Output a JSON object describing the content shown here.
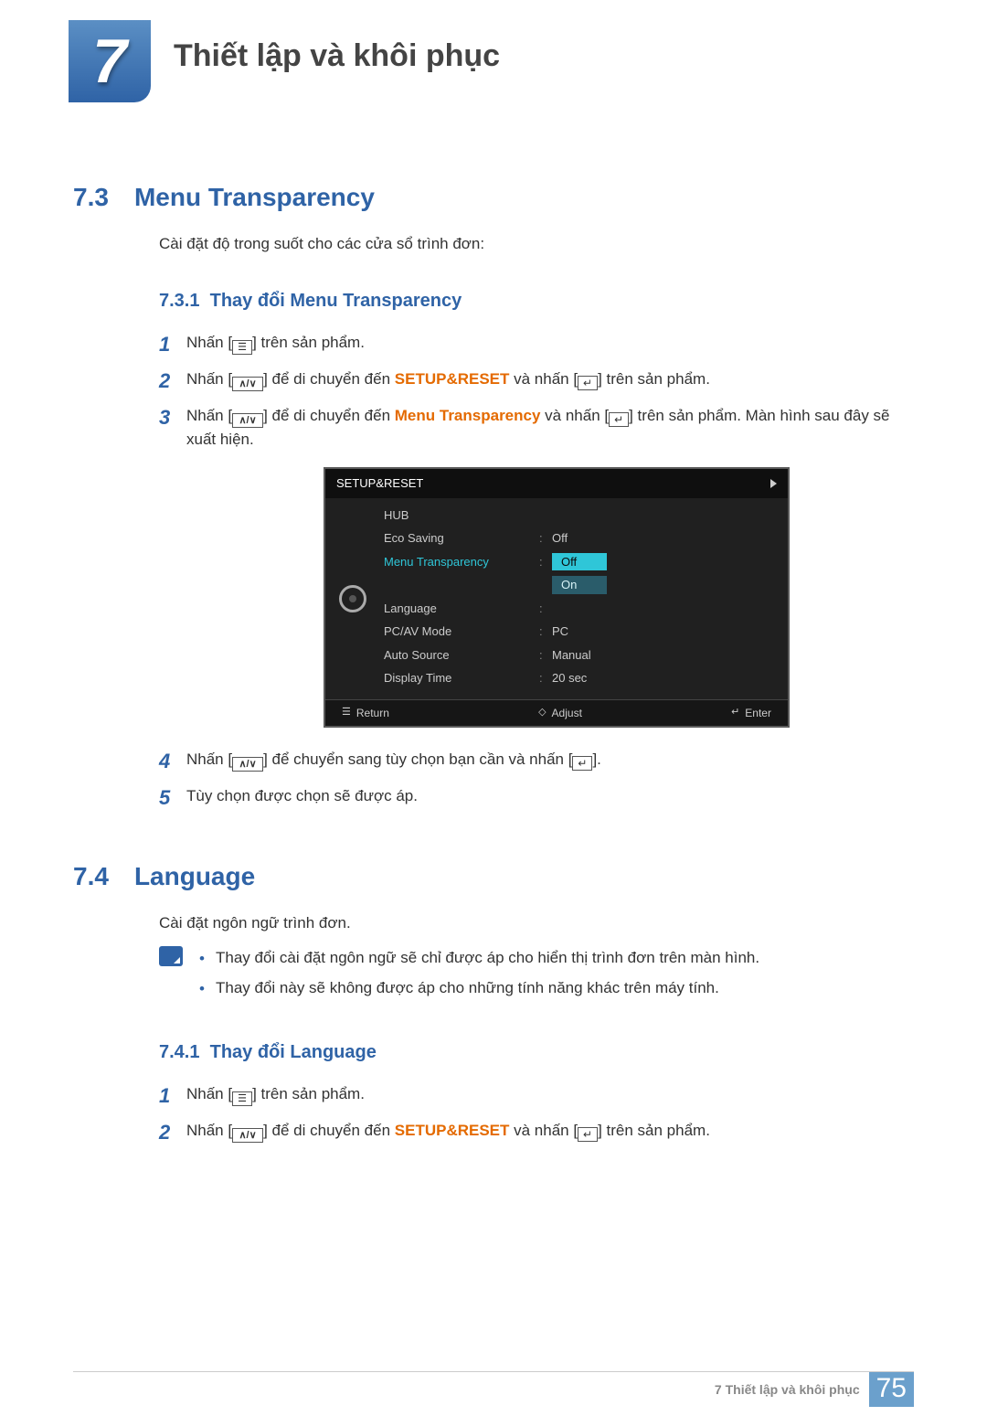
{
  "chapter": {
    "number": "7",
    "title": "Thiết lập và khôi phục"
  },
  "section73": {
    "num": "7.3",
    "title": "Menu Transparency",
    "intro": "Cài đặt độ trong suốt cho các cửa sổ trình đơn:",
    "sub": {
      "num": "7.3.1",
      "title": "Thay đổi Menu Transparency"
    },
    "steps": {
      "s1": "Nhấn [",
      "s1b": "] trên sản phẩm.",
      "s2": "Nhấn [",
      "s2b": "] để di chuyển đến ",
      "s2kw": "SETUP&RESET",
      "s2c": " và nhấn [",
      "s2d": "] trên sản phẩm.",
      "s3": "Nhấn [",
      "s3b": "] để di chuyển đến ",
      "s3kw": "Menu Transparency",
      "s3c": " và nhấn [",
      "s3d": "] trên sản phẩm. Màn hình sau đây sẽ xuất hiện.",
      "s4": "Nhấn [",
      "s4b": "] để chuyển sang tùy chọn bạn cần và nhấn [",
      "s4c": "].",
      "s5": "Tùy chọn được chọn sẽ được áp."
    }
  },
  "osd": {
    "header": "SETUP&RESET",
    "rows": {
      "hub": {
        "label": "HUB",
        "value": ""
      },
      "eco": {
        "label": "Eco Saving",
        "value": "Off"
      },
      "menutr": {
        "label": "Menu Transparency",
        "value": "Off"
      },
      "menutr_alt": {
        "value": "On"
      },
      "language": {
        "label": "Language",
        "value": ""
      },
      "pcav": {
        "label": "PC/AV Mode",
        "value": "PC"
      },
      "autosrc": {
        "label": "Auto Source",
        "value": "Manual"
      },
      "disptime": {
        "label": "Display Time",
        "value": "20 sec"
      }
    },
    "footer": {
      "return": "Return",
      "adjust": "Adjust",
      "enter": "Enter"
    }
  },
  "section74": {
    "num": "7.4",
    "title": "Language",
    "intro": "Cài đặt ngôn ngữ trình đơn.",
    "note1": "Thay đổi cài đặt ngôn ngữ sẽ chỉ được áp cho hiển thị trình đơn trên màn hình.",
    "note2": "Thay đổi này sẽ không được áp cho những tính năng khác trên máy tính.",
    "sub": {
      "num": "7.4.1",
      "title": "Thay đổi Language"
    },
    "steps": {
      "s1": "Nhấn [",
      "s1b": "] trên sản phẩm.",
      "s2": "Nhấn [",
      "s2b": "] để di chuyển đến ",
      "s2kw": "SETUP&RESET",
      "s2c": " và nhấn [",
      "s2d": "] trên sản phẩm."
    }
  },
  "footer": {
    "title": "7 Thiết lập và khôi phục",
    "page": "75"
  }
}
